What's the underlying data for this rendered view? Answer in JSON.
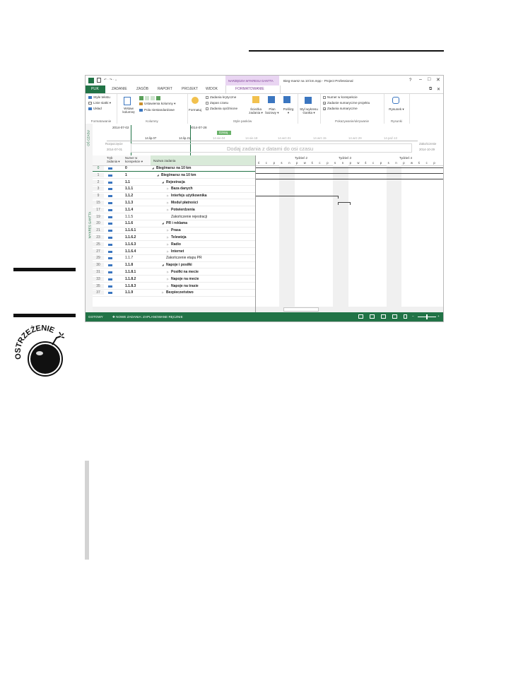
{
  "window": {
    "title": "Bieg-marsz na 10 km.mpp - Project Professional",
    "qat": "↶ · ↷ · ₌",
    "help": "?",
    "context_tab_group": "NARZĘDZIA WYKRESU GANTTA"
  },
  "tabs": [
    "PLIK",
    "ZADANIE",
    "ZASÓB",
    "RAPORT",
    "PROJEKT",
    "WIDOK",
    "FORMATOWANIE"
  ],
  "ribbon": {
    "format": {
      "items": [
        "Style tekstu",
        "Linie siatki ▾",
        "Układ"
      ],
      "group": "Formatowanie"
    },
    "columns": {
      "insert": "Wstaw kolumnę",
      "settings": "Ustawienia kolumny ▾",
      "custom": "Pola niestandardowe",
      "group": "Kolumny"
    },
    "bar_styles": {
      "format": "Formatuj",
      "checks": [
        "Zadania krytyczne",
        "Zapas czasu",
        "Zadania opóźnione"
      ],
      "task_path": "Ścieżka zadania ▾",
      "baseline": "Plan bazowy ▾",
      "slippage": "Poślizg ▾",
      "group": "Style pasków"
    },
    "gantt_style": {
      "label": "Styl wykresu Gantta ▾",
      "group": ""
    },
    "show_hide": {
      "checks": [
        "Numer w konspekcie",
        "Zadanie sumaryczne projektu",
        "Zadania sumaryczne"
      ],
      "checked": [
        false,
        true,
        true
      ],
      "group": "Pokazywanie/ukrywanie"
    },
    "drawings": {
      "label": "Rysunek ▾",
      "group": "Rysunki"
    }
  },
  "timeline": {
    "side_label": "OŚ CZASU",
    "top_dates": [
      "2014-07-02",
      "2014-07-28"
    ],
    "today": "Dzisiaj",
    "scale": [
      "14.lip.07",
      "14.lip.21",
      "14.sie.04",
      "14.sie.18",
      "14.wrz.01",
      "14.wrz.15",
      "14.wrz.29",
      "14.paź.13"
    ],
    "start_label": "Rozpoczęcie",
    "start_date": "2014-07-01",
    "finish_label": "Zakończenie",
    "finish_date": "2014-10-29",
    "placeholder": "Dodaj zadania z datami do osi czasu"
  },
  "table": {
    "side_label": "WYKRES GANTTA",
    "headers": [
      "Tryb zadania ▾",
      "Numer w konspekcie ▾",
      "Nazwa zadania"
    ],
    "rows": [
      {
        "id": "0",
        "wbs": "0",
        "name": "Bieg/marsz na 10 km",
        "level": 0,
        "bold": true,
        "arrow": "◢"
      },
      {
        "id": "1",
        "wbs": "1",
        "name": "Bieg/marsz na 10 km",
        "level": 1,
        "bold": true,
        "arrow": "◢"
      },
      {
        "id": "2",
        "wbs": "1.1",
        "name": "Rejestracja",
        "level": 2,
        "bold": true,
        "arrow": "◢"
      },
      {
        "id": "3",
        "wbs": "1.1.1",
        "name": "Baza danych",
        "level": 3,
        "bold": true,
        "arrow": "▷"
      },
      {
        "id": "9",
        "wbs": "1.1.2",
        "name": "Interfejs użytkownika",
        "level": 3,
        "bold": true,
        "arrow": "▷"
      },
      {
        "id": "15",
        "wbs": "1.1.3",
        "name": "Moduł płatności",
        "level": 3,
        "bold": true,
        "arrow": "▷"
      },
      {
        "id": "17",
        "wbs": "1.1.4",
        "name": "Potwierdzenia",
        "level": 3,
        "bold": true,
        "arrow": "▷"
      },
      {
        "id": "19",
        "wbs": "1.1.5",
        "name": "Zakończenie rejestracji",
        "level": 3,
        "bold": false,
        "arrow": ""
      },
      {
        "id": "20",
        "wbs": "1.1.6",
        "name": "PR i reklama",
        "level": 2,
        "bold": true,
        "arrow": "◢"
      },
      {
        "id": "21",
        "wbs": "1.1.6.1",
        "name": "Prasa",
        "level": 3,
        "bold": true,
        "arrow": "▷"
      },
      {
        "id": "23",
        "wbs": "1.1.6.2",
        "name": "Telewizja",
        "level": 3,
        "bold": true,
        "arrow": "▷"
      },
      {
        "id": "25",
        "wbs": "1.1.6.3",
        "name": "Radio",
        "level": 3,
        "bold": true,
        "arrow": "▷"
      },
      {
        "id": "27",
        "wbs": "1.1.6.4",
        "name": "Internet",
        "level": 3,
        "bold": true,
        "arrow": "▷"
      },
      {
        "id": "29",
        "wbs": "1.1.7",
        "name": "Zakończenie etapu PR",
        "level": 2,
        "bold": false,
        "arrow": ""
      },
      {
        "id": "30",
        "wbs": "1.1.8",
        "name": "Napoje i posiłki",
        "level": 2,
        "bold": true,
        "arrow": "◢"
      },
      {
        "id": "31",
        "wbs": "1.1.8.1",
        "name": "Posiłki na mecie",
        "level": 3,
        "bold": true,
        "arrow": "▷"
      },
      {
        "id": "33",
        "wbs": "1.1.8.2",
        "name": "Napoje na mecie",
        "level": 3,
        "bold": true,
        "arrow": "▷"
      },
      {
        "id": "35",
        "wbs": "1.1.8.3",
        "name": "Napoje na trasie",
        "level": 3,
        "bold": true,
        "arrow": "▷"
      },
      {
        "id": "37",
        "wbs": "1.1.9",
        "name": "Bezpieczeństwo",
        "level": 2,
        "bold": true,
        "arrow": "▷"
      }
    ]
  },
  "gantt": {
    "weeks": [
      "Tydzień 2",
      "Tydzień 3",
      "Tydzień 4"
    ],
    "days": [
      "ś",
      "c",
      "p",
      "s",
      "n",
      "p",
      "w",
      "ś",
      "c",
      "p",
      "s",
      "n",
      "p",
      "w",
      "ś",
      "c",
      "p",
      "s",
      "n",
      "p",
      "w",
      "ś",
      "c",
      "p"
    ]
  },
  "status": {
    "ready": "GOTOWY",
    "new_tasks": "✚ NOWE ZADANIA: ZAPLANOWANE RĘCZNIE"
  },
  "warning_icon": {
    "label": "OSTRZEŻENIE"
  },
  "colors": {
    "accent": "#217346",
    "context_tab": "#c9a0dc"
  }
}
